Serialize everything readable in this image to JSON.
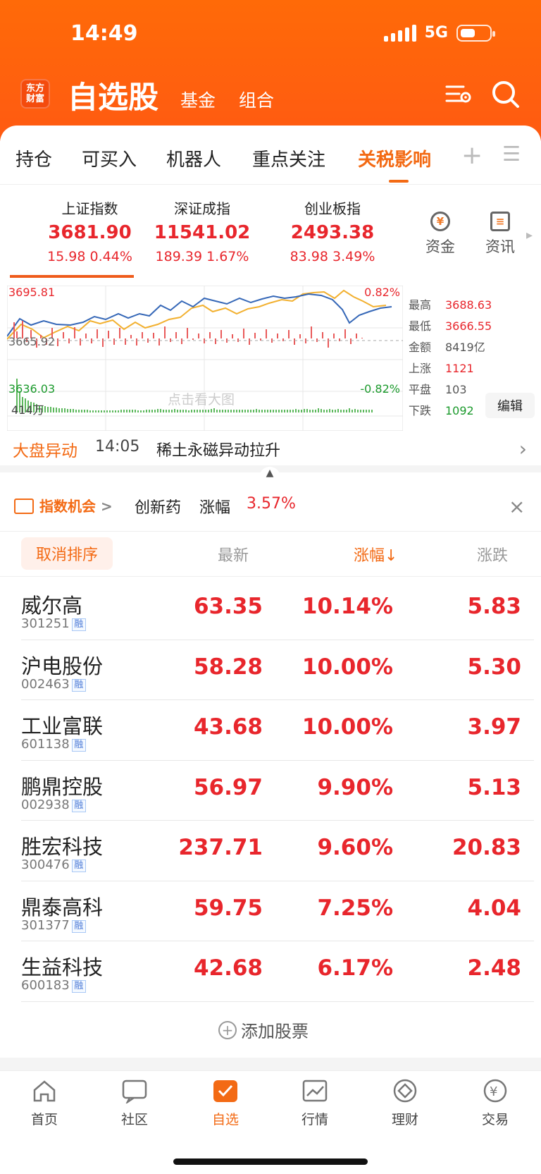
{
  "status": {
    "time": "14:49",
    "network": "5G"
  },
  "header": {
    "logo_line1": "东方",
    "logo_line2": "财富",
    "title": "自选股",
    "tabs": [
      "基金",
      "组合"
    ]
  },
  "tabs": [
    "持仓",
    "可买入",
    "机器人",
    "重点关注",
    "关税影响"
  ],
  "indices": [
    {
      "name": "上证指数",
      "value": "3681.90",
      "change": "15.98",
      "pct": "0.44%"
    },
    {
      "name": "深证成指",
      "value": "11541.02",
      "change": "189.39",
      "pct": "1.67%"
    },
    {
      "name": "创业板指",
      "value": "2493.38",
      "change": "83.98",
      "pct": "3.49%"
    }
  ],
  "tools": {
    "funds": "资金",
    "news": "资讯"
  },
  "chart": {
    "high": "3695.81",
    "base": "3665.92",
    "low": "3636.03",
    "up_pct": "0.82%",
    "down_pct": "-0.82%",
    "volume": "414万",
    "hint": "点击看大图"
  },
  "stats": {
    "high_label": "最高",
    "high": "3688.63",
    "low_label": "最低",
    "low": "3666.55",
    "amount_label": "金额",
    "amount": "8419亿",
    "up_label": "上涨",
    "up": "1121",
    "flat_label": "平盘",
    "flat": "103",
    "down_label": "下跌",
    "down": "1092",
    "edit": "编辑"
  },
  "alert": {
    "label": "大盘异动",
    "time": "14:05",
    "text": "稀土永磁异动拉升"
  },
  "opportunity": {
    "badge": "指数机会",
    "arrow": ">",
    "sector": "创新药",
    "label": "涨幅",
    "rate": "3.57%"
  },
  "sort": {
    "cancel": "取消排序",
    "latest": "最新",
    "change_pct": "涨幅↓",
    "change": "涨跌"
  },
  "stocks": [
    {
      "name": "威尔高",
      "code": "301251",
      "price": "63.35",
      "pct": "10.14%",
      "chg": "5.83"
    },
    {
      "name": "沪电股份",
      "code": "002463",
      "price": "58.28",
      "pct": "10.00%",
      "chg": "5.30"
    },
    {
      "name": "工业富联",
      "code": "601138",
      "price": "43.68",
      "pct": "10.00%",
      "chg": "3.97"
    },
    {
      "name": "鹏鼎控股",
      "code": "002938",
      "price": "56.97",
      "pct": "9.90%",
      "chg": "5.13"
    },
    {
      "name": "胜宏科技",
      "code": "300476",
      "price": "237.71",
      "pct": "9.60%",
      "chg": "20.83"
    },
    {
      "name": "鼎泰高科",
      "code": "301377",
      "price": "59.75",
      "pct": "7.25%",
      "chg": "4.04"
    },
    {
      "name": "生益科技",
      "code": "600183",
      "price": "42.68",
      "pct": "6.17%",
      "chg": "2.48"
    }
  ],
  "rz_label": "融",
  "add_stock": "添加股票",
  "bottom_nav": [
    "首页",
    "社区",
    "自选",
    "行情",
    "理财",
    "交易"
  ],
  "colors": {
    "accent": "#f36a14",
    "up": "#e8262c",
    "down": "#1b9a2c",
    "header": "#ff640e"
  }
}
